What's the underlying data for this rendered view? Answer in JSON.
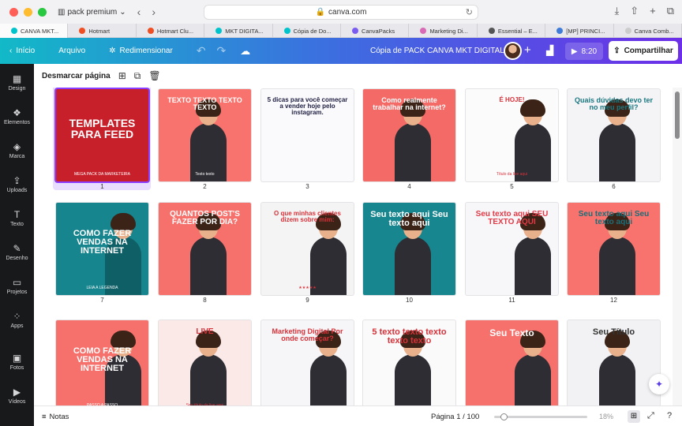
{
  "browser": {
    "profile": "pack premium",
    "url": "canva.com",
    "tabs": [
      {
        "label": "CANVA MKT...",
        "icon_color": "#00c4cc",
        "active": true
      },
      {
        "label": "Hotmart",
        "icon_color": "#f04e23",
        "active": false
      },
      {
        "label": "Hotmart Clu...",
        "icon_color": "#f04e23",
        "active": false
      },
      {
        "label": "MKT DIGITA...",
        "icon_color": "#00c4cc",
        "active": false
      },
      {
        "label": "Cópia de Do...",
        "icon_color": "#00c4cc",
        "active": false
      },
      {
        "label": "CanvaPacks",
        "icon_color": "#7b5cf0",
        "active": false
      },
      {
        "label": "Marketing Di...",
        "icon_color": "#d96ab5",
        "active": false
      },
      {
        "label": "Essential – E...",
        "icon_color": "#555555",
        "active": false
      },
      {
        "label": "[MP] PRINCI...",
        "icon_color": "#3f7bd9",
        "active": false
      },
      {
        "label": "Canva Comb...",
        "icon_color": "#cccccc",
        "active": false
      }
    ]
  },
  "topbar": {
    "home": "Início",
    "file": "Arquivo",
    "resize": "Redimensionar",
    "doc_title": "Cópia de PACK CANVA MKT DIGITAL 8",
    "play_time": "8:20",
    "share": "Compartilhar"
  },
  "sidebar": {
    "items": [
      {
        "label": "Design",
        "icon": "layout-icon",
        "glyph": "▦"
      },
      {
        "label": "Elementos",
        "icon": "elements-icon",
        "glyph": "❖"
      },
      {
        "label": "Marca",
        "icon": "brand-icon",
        "glyph": "◈"
      },
      {
        "label": "Uploads",
        "icon": "upload-icon",
        "glyph": "⇪"
      },
      {
        "label": "Texto",
        "icon": "text-icon",
        "glyph": "T"
      },
      {
        "label": "Desenho",
        "icon": "draw-icon",
        "glyph": "✎"
      },
      {
        "label": "Projetos",
        "icon": "folder-icon",
        "glyph": "▭"
      },
      {
        "label": "Apps",
        "icon": "apps-icon",
        "glyph": "⁘"
      },
      {
        "label": "Fotos",
        "icon": "photo-icon",
        "glyph": "▣"
      },
      {
        "label": "Vídeos",
        "icon": "video-icon",
        "glyph": "▶"
      }
    ]
  },
  "toolbar": {
    "deselect": "Desmarcar página"
  },
  "pages": [
    {
      "num": "1",
      "bg": "#c8202b",
      "text": "TEMPLATES PARA FEED",
      "sub": "MEGA PACK DA MARKETEIRA",
      "text_color": "#ffffff"
    },
    {
      "num": "2",
      "bg": "#f8736d",
      "text": "TEXTO TEXTO TEXTO TEXTO",
      "sub": "Texto texto",
      "text_color": "#ffffff"
    },
    {
      "num": "3",
      "bg": "#fafafd",
      "text": "5 dicas para você começar a vender hoje pelo instagram.",
      "sub": "",
      "text_color": "#222244"
    },
    {
      "num": "4",
      "bg": "#f46a67",
      "text": "Como realmente trabalhar na internet?",
      "sub": "",
      "text_color": "#ffffff"
    },
    {
      "num": "5",
      "bg": "#fbfbfb",
      "text": "É HOJE!",
      "sub": "Título da live aqui",
      "text_color": "#d8323a"
    },
    {
      "num": "6",
      "bg": "#f4f4f6",
      "text": "Quais dúvidas devo ter no meu perfil?",
      "sub": "",
      "text_color": "#1a7780"
    },
    {
      "num": "7",
      "bg": "#17858e",
      "text": "COMO FAZER VENDAS NA INTERNET",
      "sub": "LEIA A LEGENDA",
      "text_color": "#ffffff"
    },
    {
      "num": "8",
      "bg": "#f7716c",
      "text": "QUANTOS POST'S FAZER POR DIA?",
      "sub": "",
      "text_color": "#ffffff"
    },
    {
      "num": "9",
      "bg": "#f4f4f4",
      "text": "O que minhas clientes dizem sobre mim:",
      "sub": "★★★★★",
      "text_color": "#d8323a"
    },
    {
      "num": "10",
      "bg": "#18868f",
      "text": "Seu texto aqui Seu texto aqui",
      "sub": "",
      "text_color": "#ffffff"
    },
    {
      "num": "11",
      "bg": "#f7f7f9",
      "text": "Seu texto aqui SEU TEXTO AQUI",
      "sub": "",
      "text_color": "#e33a47"
    },
    {
      "num": "12",
      "bg": "#f8736d",
      "text": "Seu texto aqui Seu texto aqui",
      "sub": "",
      "text_color": "#1b6e79"
    },
    {
      "num": "",
      "bg": "#f7716c",
      "text": "COMO FAZER VENDAS NA INTERNET",
      "sub": "PASSO A PASSO",
      "text_color": "#ffffff"
    },
    {
      "num": "",
      "bg": "#fbe9e8",
      "text": "LIVE",
      "sub": "Seu título da live aqui",
      "text_color": "#d8323a"
    },
    {
      "num": "",
      "bg": "#f6f6f8",
      "text": "Marketing Digital Por onde começar?",
      "sub": "",
      "text_color": "#d8323a"
    },
    {
      "num": "",
      "bg": "#fafafa",
      "text": "5 texto texto texto texto texto",
      "sub": "",
      "text_color": "#d8323a"
    },
    {
      "num": "",
      "bg": "#f7716c",
      "text": "Seu Texto",
      "sub": "",
      "text_color": "#ffffff"
    },
    {
      "num": "",
      "bg": "#f2f2f4",
      "text": "Seu Título",
      "sub": "",
      "text_color": "#333333"
    }
  ],
  "footer": {
    "notes": "Notas",
    "page_indicator": "Página 1 / 100",
    "zoom": "18%"
  }
}
